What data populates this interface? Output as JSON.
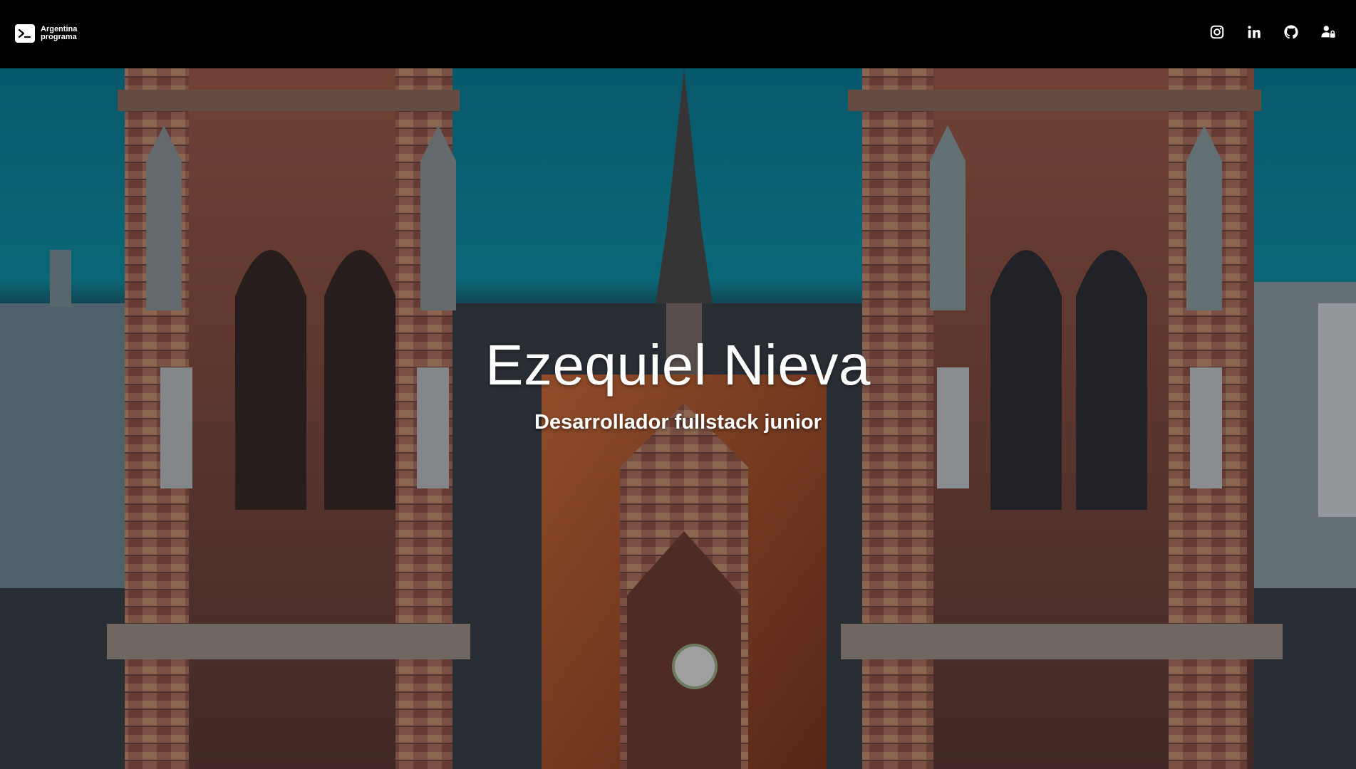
{
  "navbar": {
    "brand": {
      "line1": "Argentina",
      "line2": "programa",
      "icon": "terminal-prompt-icon"
    },
    "social_links": [
      {
        "name": "instagram",
        "icon": "instagram-icon"
      },
      {
        "name": "linkedin",
        "icon": "linkedin-icon"
      },
      {
        "name": "github",
        "icon": "github-icon"
      },
      {
        "name": "login",
        "icon": "user-lock-icon"
      }
    ]
  },
  "hero": {
    "title": "Ezequiel Nieva",
    "subtitle": "Desarrollador fullstack junior",
    "background": "photo-gothic-cathedral-towers"
  },
  "colors": {
    "navbar_bg": "#000000",
    "sky": "#0d8aa0",
    "text": "#ffffff"
  }
}
